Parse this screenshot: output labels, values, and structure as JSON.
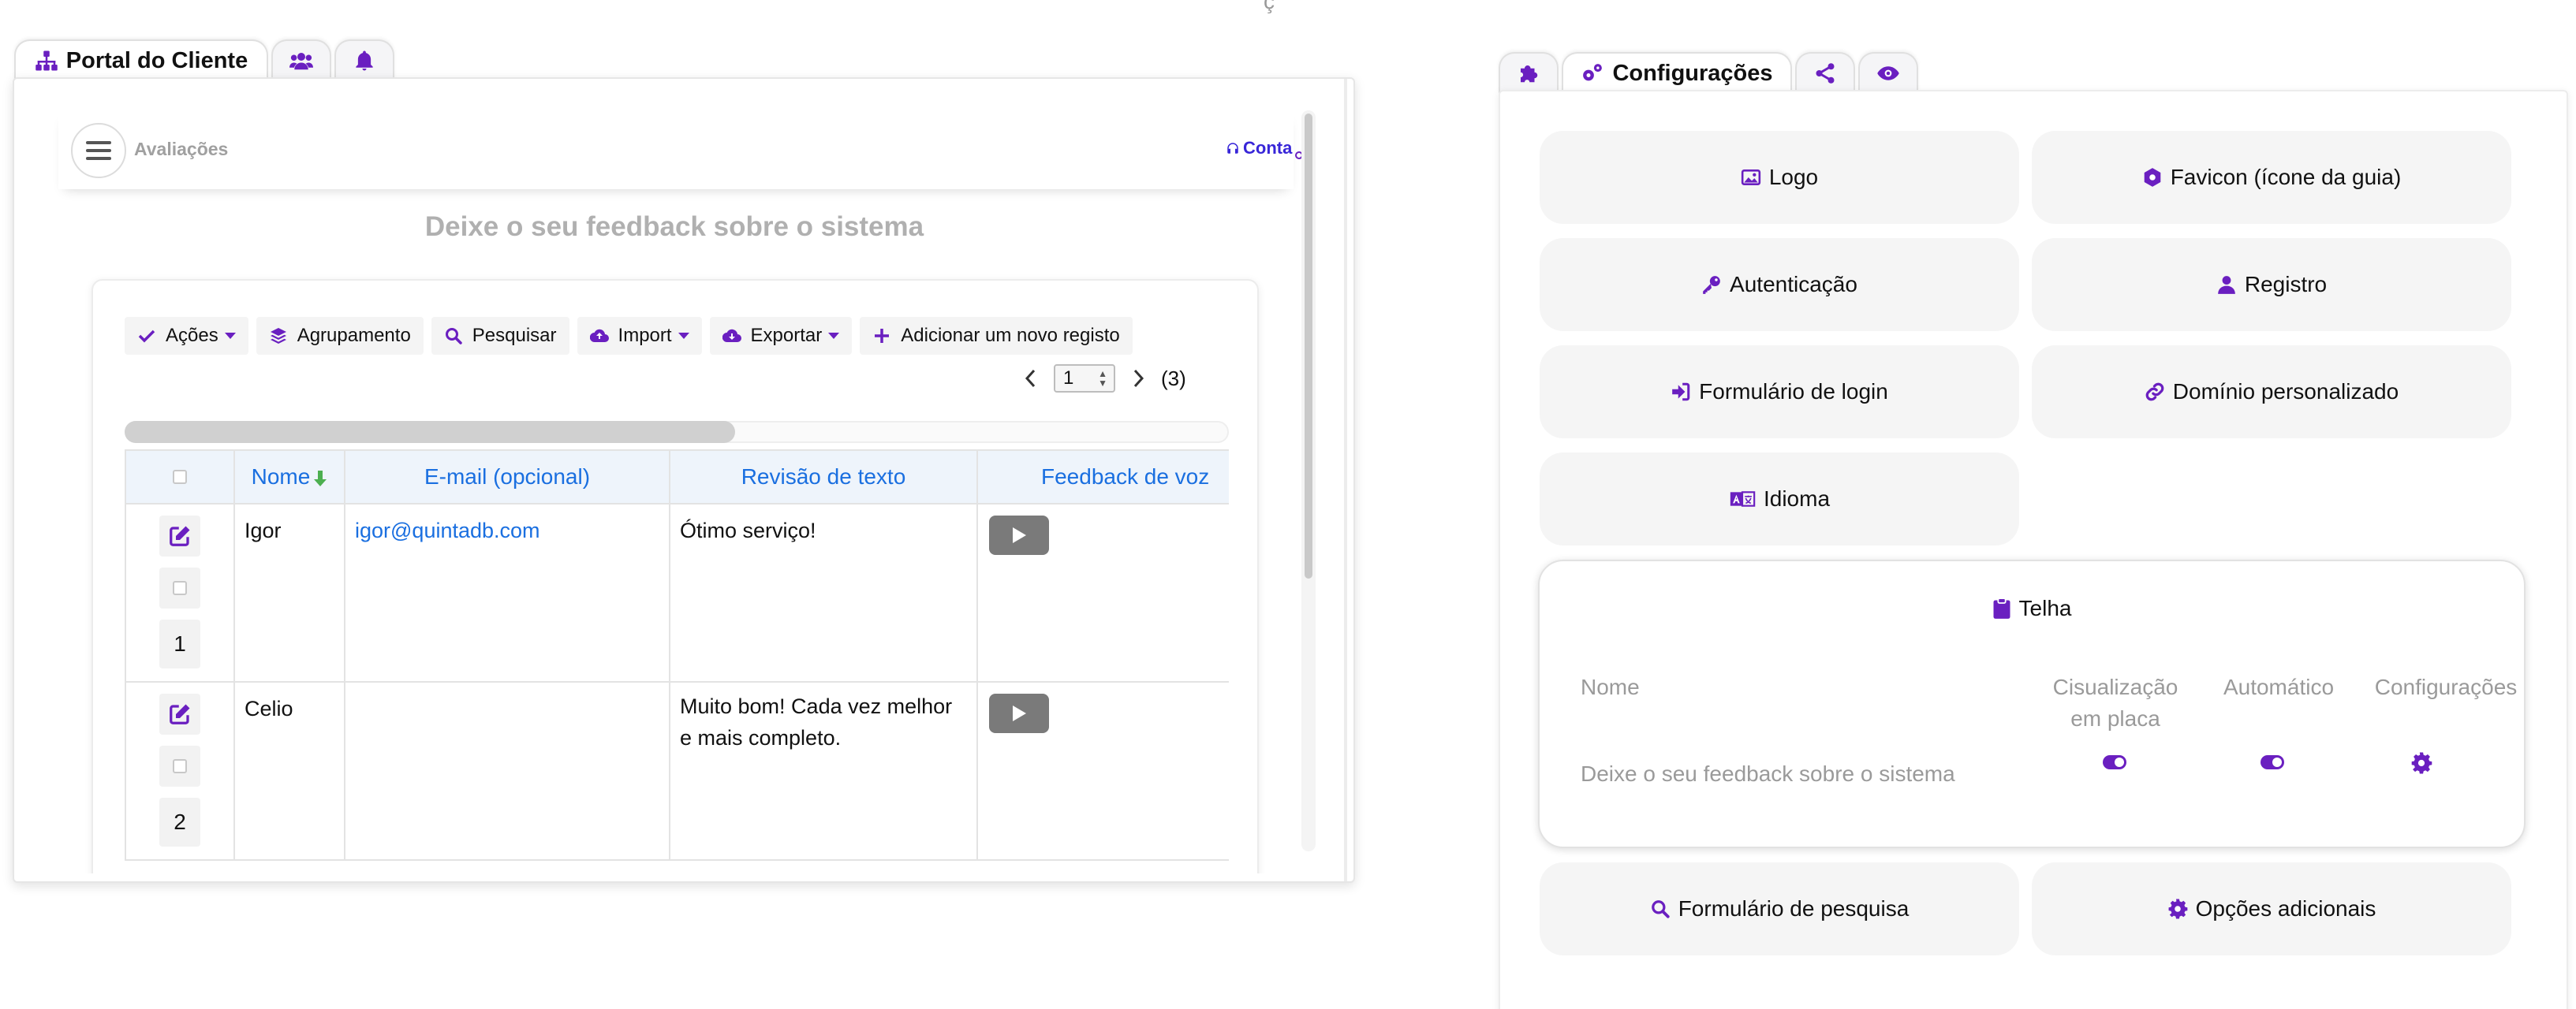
{
  "top_overflow_glyph": "ç",
  "left_pane": {
    "tabs": [
      {
        "label": "Portal do Cliente",
        "icon": "sitemap-icon",
        "active": true
      },
      {
        "label": "",
        "icon": "users-icon",
        "active": false
      },
      {
        "label": "",
        "icon": "bell-icon",
        "active": false
      }
    ],
    "header": {
      "title": "Avaliações",
      "account_label": "Conta"
    },
    "page_heading": "Deixe o seu feedback sobre o sistema",
    "toolbar": {
      "actions": "Ações",
      "grouping": "Agrupamento",
      "search": "Pesquisar",
      "import": "Import",
      "export": "Exportar",
      "add_new": "Adicionar um novo registo"
    },
    "pager": {
      "current_page": "1",
      "total": "(3)"
    },
    "table": {
      "columns": [
        "Nome",
        "E-mail (opcional)",
        "Revisão de texto",
        "Feedback de voz"
      ],
      "rows": [
        {
          "num": "1",
          "name": "Igor",
          "email": "igor@quintadb.com",
          "review": "Ótimo serviço!"
        },
        {
          "num": "2",
          "name": "Celio",
          "email": "",
          "review": "Muito bom! Cada vez melhor e mais completo."
        }
      ]
    }
  },
  "right_pane": {
    "tabs": [
      {
        "label": "",
        "icon": "puzzle-icon",
        "active": false
      },
      {
        "label": "Configurações",
        "icon": "cogs-icon",
        "active": true
      },
      {
        "label": "",
        "icon": "share-icon",
        "active": false
      },
      {
        "label": "",
        "icon": "eye-icon",
        "active": false
      }
    ],
    "buttons": {
      "logo": "Logo",
      "favicon": "Favicon (ícone da guia)",
      "auth": "Autenticação",
      "registration": "Registro",
      "login_form": "Formulário de login",
      "custom_domain": "Domínio personalizado",
      "language": "Idioma",
      "search_form": "Formulário de pesquisa",
      "additional_options": "Opções adicionais"
    },
    "tile": {
      "title": "Telha",
      "col_name": "Nome",
      "col_view_line1": "Cisualização",
      "col_view_line2": "em placa",
      "col_auto": "Automático",
      "col_settings": "Configurações",
      "row_name": "Deixe o seu feedback sobre o sistema",
      "view_enabled": true,
      "auto_enabled": true
    }
  },
  "colors": {
    "accent": "#6a1fc0",
    "link": "#1a6fe0",
    "header_bg": "#eef4fb",
    "button_bg": "#f5f5f5"
  }
}
